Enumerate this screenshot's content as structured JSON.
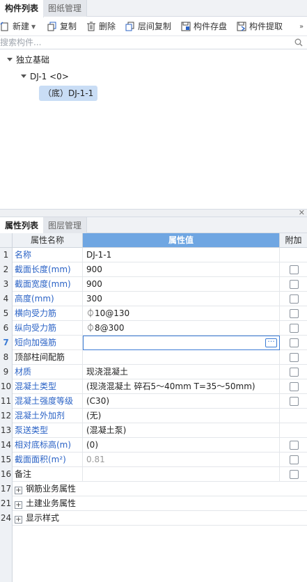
{
  "top_tabs": [
    "构件列表",
    "图纸管理"
  ],
  "toolbar": {
    "new": "新建",
    "copy": "复制",
    "delete": "删除",
    "layer_copy": "层间复制",
    "save": "构件存盘",
    "extract": "构件提取"
  },
  "search": {
    "placeholder": "搜索构件..."
  },
  "tree": {
    "root": "独立基础",
    "child": "DJ-1 <0>",
    "leaf": "（底）DJ-1-1"
  },
  "bottom_tabs": [
    "属性列表",
    "图层管理"
  ],
  "grid": {
    "headers": {
      "name": "属性名称",
      "value": "属性值",
      "extra": "附加"
    },
    "rows": [
      {
        "num": "1",
        "name": "名称",
        "value": "DJ-1-1"
      },
      {
        "num": "2",
        "name": "截面长度(mm)",
        "value": "900"
      },
      {
        "num": "3",
        "name": "截面宽度(mm)",
        "value": "900"
      },
      {
        "num": "4",
        "name": "高度(mm)",
        "value": "300"
      },
      {
        "num": "5",
        "name": "横向受力筋",
        "value": "⏀10@130"
      },
      {
        "num": "6",
        "name": "纵向受力筋",
        "value": "⏀8@300"
      },
      {
        "num": "7",
        "name": "短向加强筋",
        "value": ""
      },
      {
        "num": "8",
        "name": "顶部柱间配筋",
        "value": ""
      },
      {
        "num": "9",
        "name": "材质",
        "value": "现浇混凝土"
      },
      {
        "num": "10",
        "name": "混凝土类型",
        "value": "(现浇混凝土   碎石5～40mm  T=35～50mm)"
      },
      {
        "num": "11",
        "name": "混凝土强度等级",
        "value": "(C30)"
      },
      {
        "num": "12",
        "name": "混凝土外加剂",
        "value": "(无)"
      },
      {
        "num": "13",
        "name": "泵送类型",
        "value": "(混凝土泵)"
      },
      {
        "num": "14",
        "name": "相对底标高(m)",
        "value": "(0)"
      },
      {
        "num": "15",
        "name": "截面面积(m²)",
        "value": "0.81"
      },
      {
        "num": "16",
        "name": "备注",
        "value": ""
      },
      {
        "num": "17",
        "name": "钢筋业务属性",
        "value": ""
      },
      {
        "num": "21",
        "name": "土建业务属性",
        "value": ""
      },
      {
        "num": "24",
        "name": "显示样式",
        "value": ""
      }
    ]
  },
  "colors": {
    "header_value_bg": "#6fa6e2",
    "link_blue": "#2b63c6",
    "selection": "#c9ddf5"
  }
}
